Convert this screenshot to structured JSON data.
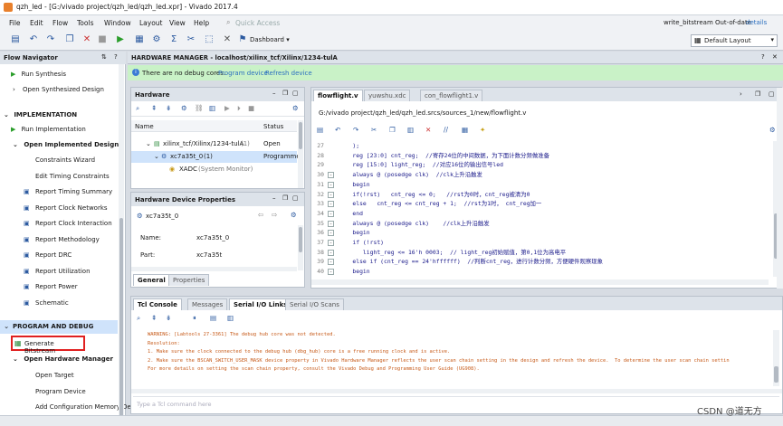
{
  "titlebar": {
    "title": "qzh_led - [G:/vivado project/qzh_led/qzh_led.xpr] - Vivado 2017.4"
  },
  "menubar": {
    "items": [
      "File",
      "Edit",
      "Flow",
      "Tools",
      "Window",
      "Layout",
      "View",
      "Help"
    ],
    "quick_access_placeholder": "Quick Access",
    "status_text": "write_bitstream Out-of-date",
    "details_link": "details"
  },
  "toolbar": {
    "dashboard_label": "Dashboard",
    "layout_select": "Default Layout"
  },
  "flow_navigator": {
    "title": "Flow Navigator",
    "run_synthesis": "Run Synthesis",
    "open_synth_design": "Open Synthesized Design",
    "implementation_header": "IMPLEMENTATION",
    "run_implementation": "Run Implementation",
    "open_impl_design": "Open Implemented Design",
    "impl_items": [
      "Constraints Wizard",
      "Edit Timing Constraints",
      "Report Timing Summary",
      "Report Clock Networks",
      "Report Clock Interaction",
      "Report Methodology",
      "Report DRC",
      "Report Utilization",
      "Report Power",
      "Schematic"
    ],
    "program_header": "PROGRAM AND DEBUG",
    "generate_bitstream": "Generate Bitstream",
    "open_hw_manager": "Open Hardware Manager",
    "hw_items": [
      "Open Target",
      "Program Device",
      "Add Configuration Memory De"
    ]
  },
  "hw_manager": {
    "title": "HARDWARE MANAGER - localhost/xilinx_tcf/Xilinx/1234-tulA",
    "banner_text": "There are no debug cores.",
    "program_device_link": "Program device",
    "refresh_device_link": "Refresh device"
  },
  "hardware_panel": {
    "title": "Hardware",
    "col_name": "Name",
    "col_status": "Status",
    "rows": [
      {
        "name": "xilinx_tcf/Xilinx/1234-tulA",
        "suffix": "(1)",
        "status": "Open"
      },
      {
        "name": "xc7a35t_0",
        "suffix": "(1)",
        "status": "Programme"
      },
      {
        "name": "XADC",
        "suffix": "(System Monitor)",
        "status": ""
      }
    ]
  },
  "device_props": {
    "title": "Hardware Device Properties",
    "device": "xc7a35t_0",
    "name_label": "Name:",
    "name_value": "xc7a35t_0",
    "part_label": "Part:",
    "part_value": "xc7a35t",
    "tabs": [
      "General",
      "Properties"
    ]
  },
  "editor": {
    "tabs": [
      "flowflight.v",
      "yuwshu.xdc",
      "con_flowflight1.v"
    ],
    "path": "G:/vivado project/qzh_led/qzh_led.srcs/sources_1/new/flowflight.v",
    "lines": [
      {
        "n": "27",
        "t": "    );"
      },
      {
        "n": "28",
        "t": "    reg [23:0] cnt_reg;  //寄存24位的中间数据，为下面计数分频做准备"
      },
      {
        "n": "29",
        "t": "    reg [15:0] light_reg;  //对应16位的输出信号led"
      },
      {
        "n": "30",
        "t": "    always @ (posedge clk)  //clk上升沿触发"
      },
      {
        "n": "31",
        "t": "    begin"
      },
      {
        "n": "32",
        "t": "    if(!rst)   cnt_reg <= 0;   //rst为0时，cnt_reg被清为0"
      },
      {
        "n": "33",
        "t": "    else   cnt_reg <= cnt_reg + 1;  //rst为1时， cnt_reg加一"
      },
      {
        "n": "34",
        "t": "    end"
      },
      {
        "n": "35",
        "t": "    always @ (posedge clk)    //clk上升沿触发"
      },
      {
        "n": "36",
        "t": "    begin"
      },
      {
        "n": "37",
        "t": "    if (!rst)"
      },
      {
        "n": "38",
        "t": "       light_reg <= 16'h 0003;  // light_reg初始赋值，第0,1位为高电平"
      },
      {
        "n": "39",
        "t": "    else if (cnt_reg == 24'hffffff)  //判断cnt_reg，进行计数分频，方便硬件观察现象"
      },
      {
        "n": "40",
        "t": "    begin"
      }
    ]
  },
  "console": {
    "tabs": [
      "Tcl Console",
      "Messages",
      "Serial I/O Links",
      "Serial I/O Scans"
    ],
    "lines": [
      "WARNING: [Labtools 27-3361] The debug hub core was not detected.",
      "Resolution:",
      "1. Make sure the clock connected to the debug hub (dbg_hub) core is a free running clock and is active.",
      "2. Make sure the BSCAN_SWITCH_USER_MASK device property in Vivado Hardware Manager reflects the user scan chain setting in the design and refresh the device.  To determine the user scan chain settin",
      "For more details on setting the scan chain property, consult the Vivado Debug and Programming User Guide (UG908)."
    ],
    "input_placeholder": "Type a Tcl command here"
  },
  "watermark": "CSDN @道无方",
  "colors": {
    "accent": "#2c6fbf",
    "banner": "#c9f2c7",
    "highlight": "#cfe3fb",
    "redbox": "#e02020"
  }
}
